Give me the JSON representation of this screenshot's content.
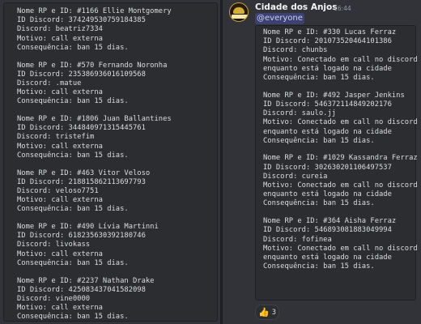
{
  "left_message": {
    "entries": [
      [
        "Nome RP e ID: #1166 Ellie Montgomery",
        "ID Discord: 374249530759184385",
        "Discord: beatriz7334",
        "Motivo: call externa",
        "Consequência: ban 15 dias."
      ],
      [
        "Nome RP e ID: #570 Fernando Noronha",
        "ID Discord: 235386936016109568",
        "Discord: .matue",
        "Motivo: call externa",
        "Consequência: ban 15 dias."
      ],
      [
        "Nome RP e ID: #1806 Juan Ballantines",
        "ID Discord: 344840971315445761",
        "Discord: tristefim",
        "Motivo: call externa",
        "Consequência: ban 15 dias."
      ],
      [
        "Nome RP e ID: #463 Vitor Veloso",
        "ID Discord: 218815862113697793",
        "Discord: veloso7751",
        "Motivo: call externa",
        "Consequência: ban 15 dias."
      ],
      [
        "Nome RP e ID: #490 Lívia Martinni",
        "ID Discord: 618235630392180746",
        "Discord: livokass",
        "Motivo: call externa",
        "Consequência: ban 15 dias."
      ],
      [
        "Nome RP e ID: #2237 Nathan Drake",
        "ID Discord: 425083437041582098",
        "Discord: vine0000",
        "Motivo: call externa",
        "Consequência: ban 15 dias."
      ]
    ]
  },
  "right_message": {
    "author": "Cidade dos Anjos",
    "timestamp": "16:44",
    "mention": "@everyone",
    "entries": [
      [
        "Nome RP e ID: #330 Lucas Ferraz",
        "ID Discord: 201073520464101386",
        "Discord: chunbs",
        "Motivo: Conectado em call no discord",
        "enquanto está logado na cidade",
        "Consequência: ban 15 dias."
      ],
      [
        "Nome RP e ID: #492 Jasper Jenkins",
        "ID Discord: 546372114849202176",
        "Discord: saulo.jj",
        "Motivo: Conectado em call no discord",
        "enquanto está logado na cidade",
        "Consequência: ban 15 dias."
      ],
      [
        "Nome RP e ID: #1029 Kassandra Ferraz",
        "ID Discord: 302630201106497537",
        "Discord: cureia",
        "Motivo: Conectado em call no discord",
        "enquanto está logado na cidade",
        "Consequência: ban 15 dias."
      ],
      [
        "Nome RP e ID: #364 Aisha Ferraz",
        "ID Discord: 546893081883049994",
        "Discord: fofinea",
        "Motivo: Conectado em call no discord",
        "enquanto está logado na cidade",
        "Consequência: ban 15 dias."
      ]
    ],
    "reaction": {
      "emoji": "👍",
      "icon": "thumbs-up-icon",
      "count": "3"
    }
  },
  "colors": {
    "background": "#313338",
    "codeblock": "#2b2d31",
    "text": "#dbdee1",
    "mention": "#c9cdfb"
  }
}
